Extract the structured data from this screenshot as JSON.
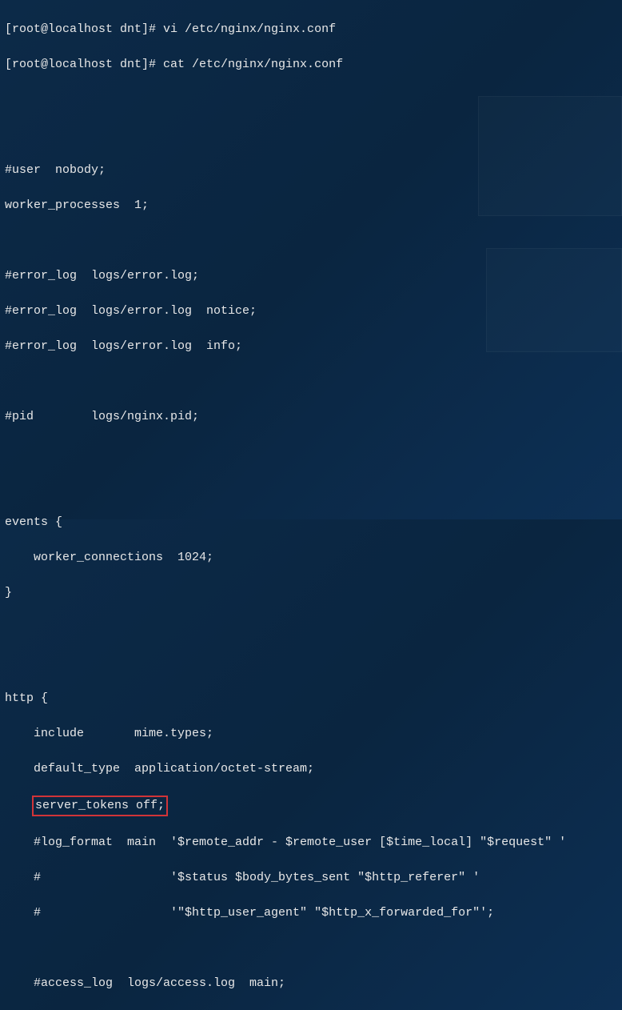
{
  "prompt1": "[root@localhost dnt]# vi /etc/nginx/nginx.conf",
  "prompt2": "[root@localhost dnt]# cat /etc/nginx/nginx.conf",
  "blank": "",
  "cfg": {
    "user": "#user  nobody;",
    "worker_processes": "worker_processes  1;",
    "error_log1": "#error_log  logs/error.log;",
    "error_log2": "#error_log  logs/error.log  notice;",
    "error_log3": "#error_log  logs/error.log  info;",
    "pid": "#pid        logs/nginx.pid;",
    "events_open": "events {",
    "worker_connections": "    worker_connections  1024;",
    "events_close": "}",
    "http_open": "http {",
    "include": "    include       mime.types;",
    "default_type": "    default_type  application/octet-stream;",
    "server_tokens_indent": "    ",
    "server_tokens": "server_tokens off;",
    "log_format1": "    #log_format  main  '$remote_addr - $remote_user [$time_local] \"$request\" '",
    "log_format2": "    #                  '$status $body_bytes_sent \"$http_referer\" '",
    "log_format3": "    #                  '\"$http_user_agent\" \"$http_x_forwarded_for\"';",
    "access_log": "    #access_log  logs/access.log  main;"
  }
}
